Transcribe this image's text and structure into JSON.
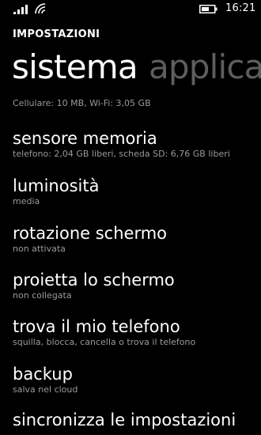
{
  "status_bar": {
    "time": "16:21",
    "icons": [
      "signal-strength-icon",
      "wifi-icon",
      "battery-icon"
    ]
  },
  "header": {
    "app_title": "IMPOSTAZIONI",
    "pivot_tabs": [
      {
        "label": "sistema",
        "active": true
      },
      {
        "label": "applica",
        "active": false
      }
    ]
  },
  "settings": {
    "items": [
      {
        "subtitle": "Cellulare: 10 MB, Wi-Fi: 3,05 GB"
      },
      {
        "title": "sensore memoria",
        "subtitle": "telefono: 2,04 GB liberi, scheda SD: 6,76 GB liberi"
      },
      {
        "title": "luminosità",
        "subtitle": "media"
      },
      {
        "title": "rotazione schermo",
        "subtitle": "non attivata"
      },
      {
        "title": "proietta lo schermo",
        "subtitle": "non collegata"
      },
      {
        "title": "trova il mio telefono",
        "subtitle": "squilla, blocca, cancella o trova il telefono"
      },
      {
        "title": "backup",
        "subtitle": "salva nel cloud"
      },
      {
        "title": "sincronizza le impostazioni"
      }
    ]
  },
  "colors": {
    "background": "#000000",
    "text": "#ffffff",
    "subtitle": "#9a9a9a",
    "inactive_pivot": "#5e5e5e"
  }
}
